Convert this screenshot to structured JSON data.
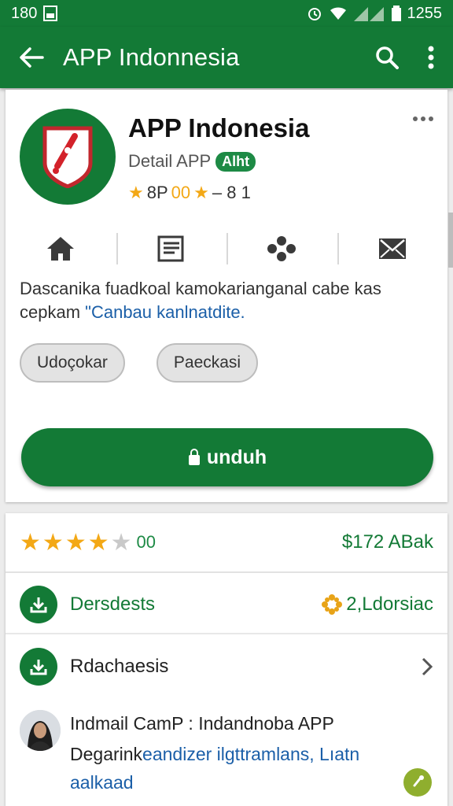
{
  "status_bar": {
    "left_text": "180",
    "right_text": "1255"
  },
  "app_bar": {
    "title": "APP Indonnesia",
    "icons": [
      "back-arrow-icon",
      "search-icon",
      "more-vert-icon"
    ]
  },
  "app_info": {
    "name": "APP Indonesia",
    "subtitle": "Detail APP",
    "badge": "Alht",
    "rating_text": "8P",
    "rating_accent": "00",
    "rating_suffix": "– 8 1"
  },
  "action_icons": [
    "home-icon",
    "list-icon",
    "share-icon",
    "mail-icon"
  ],
  "description": {
    "text": "Dascanika fuadkoal kamokarianganаl cabe kas cepkam ",
    "link": "\"Canbau kanlnatdite."
  },
  "chips": [
    "Udoçokar",
    "Paeckasi"
  ],
  "download_button": "unduh",
  "rating_row": {
    "stars_filled": 4,
    "stars_total": 5,
    "score": "00",
    "price": "$172 ABak"
  },
  "list": [
    {
      "label": "Dersdests",
      "meta": "2,Ldorsiac"
    },
    {
      "label": "Rdachaesis"
    }
  ],
  "review": {
    "title": "Indmail CamP : Indandnoba APP",
    "body_dark": "Degarink",
    "body_link": "eandizer ilgttramlans, Lıatn aalkaad"
  },
  "colors": {
    "primary": "#137a36",
    "star": "#f3a816",
    "link": "#1b5fa8"
  }
}
